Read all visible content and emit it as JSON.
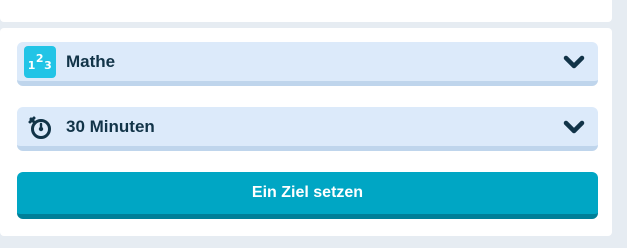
{
  "subject_select": {
    "selected_label": "Mathe",
    "icon": "number-123-icon",
    "icon_digits": [
      "1",
      "2",
      "3"
    ]
  },
  "duration_select": {
    "selected_label": "30 Minuten",
    "icon": "stopwatch-icon"
  },
  "goal_button": {
    "label": "Ein Ziel setzen"
  },
  "colors": {
    "select_bg": "#dceafa",
    "select_border": "#bfd5ec",
    "text_dark": "#123448",
    "badge_bg": "#22c4e6",
    "button_bg": "#00a6c4",
    "button_border": "#007f98",
    "page_bg": "#e6ecf2"
  }
}
